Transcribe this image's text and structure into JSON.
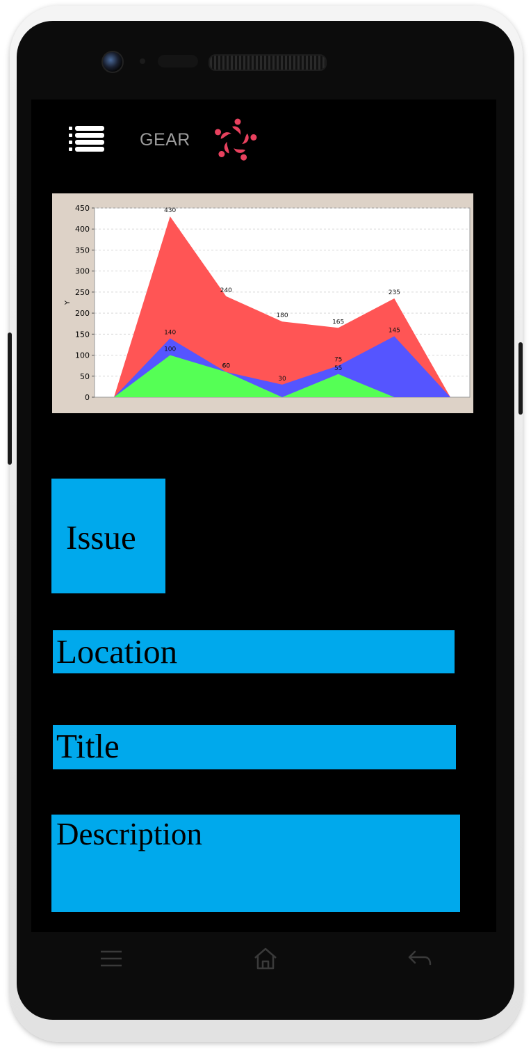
{
  "app": {
    "title": "GEAR"
  },
  "chart_data": {
    "type": "area",
    "ylabel": "Y",
    "ylim": [
      0,
      450
    ],
    "yticks": [
      0,
      50,
      100,
      150,
      200,
      250,
      300,
      350,
      400,
      450
    ],
    "x": [
      0,
      1,
      2,
      3,
      4,
      5,
      6
    ],
    "grid": true,
    "series": [
      {
        "values": [
          0,
          430,
          240,
          180,
          165,
          235,
          0
        ],
        "color": "#ff5555",
        "labels": [
          "",
          "430",
          "240",
          "180",
          "165",
          "235",
          ""
        ]
      },
      {
        "values": [
          0,
          140,
          60,
          30,
          75,
          145,
          0
        ],
        "color": "#5555ff",
        "labels": [
          "",
          "140",
          "60",
          "30",
          "75",
          "145",
          ""
        ]
      },
      {
        "values": [
          0,
          100,
          60,
          0,
          55,
          0,
          0
        ],
        "color": "#55ff55",
        "labels": [
          "",
          "100",
          "60",
          "",
          "55",
          "",
          ""
        ]
      }
    ]
  },
  "fields": {
    "issue": "Issue",
    "location": "Location",
    "title": "Title",
    "description": "Description"
  },
  "icons": {
    "menu": "list-menu-icon",
    "logo": "pinwheel-people-logo",
    "nav_menu": "hamburger-icon",
    "nav_home": "home-icon",
    "nav_back": "back-arrow-icon"
  },
  "colors": {
    "field_bg": "#00a9ec",
    "screen_bg": "#000000",
    "logo": "#e8415e",
    "chart_frame": "#ddd2c7"
  }
}
